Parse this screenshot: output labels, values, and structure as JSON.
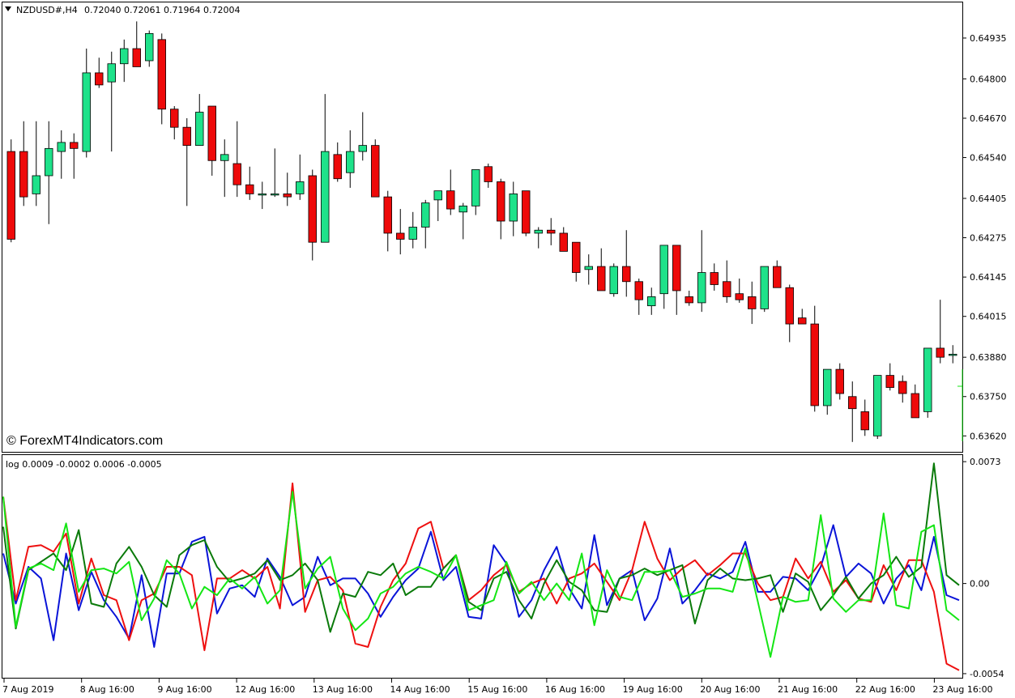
{
  "header": {
    "symbol": "NZDUSD#,H4",
    "ohlc": "0.72040 0.72061 0.71964 0.72004",
    "indicator_label": "log 0.0009 -0.0002 0.0006 -0.0005"
  },
  "watermark": "© ForexMT4Indicators.com",
  "colors": {
    "bull": "#1ee28a",
    "bear": "#ee0a0a",
    "wick": "#000000",
    "blue": "#0a14d8",
    "red": "#ee1010",
    "darkgreen": "#0a7a0a",
    "lime": "#14e614"
  },
  "chart_data": [
    {
      "type": "candlestick",
      "price_ticks": [
        "0.64935",
        "0.64800",
        "0.64670",
        "0.64540",
        "0.64405",
        "0.64275",
        "0.64145",
        "0.64015",
        "0.63880",
        "0.63750",
        "0.63620"
      ],
      "ylim": [
        0.6357,
        0.6505
      ],
      "x_labels": [
        "7 Aug 2019",
        "8 Aug 16:00",
        "9 Aug 16:00",
        "12 Aug 16:00",
        "13 Aug 16:00",
        "14 Aug 16:00",
        "15 Aug 16:00",
        "16 Aug 16:00",
        "19 Aug 16:00",
        "20 Aug 16:00",
        "21 Aug 16:00",
        "22 Aug 16:00",
        "23 Aug 16:00"
      ],
      "candles": [
        [
          0.6456,
          0.646,
          0.6426,
          0.6427
        ],
        [
          0.6456,
          0.6466,
          0.6438,
          0.6441
        ],
        [
          0.6442,
          0.6466,
          0.6438,
          0.6448
        ],
        [
          0.6448,
          0.6466,
          0.6432,
          0.6457
        ],
        [
          0.6456,
          0.6463,
          0.6447,
          0.6459
        ],
        [
          0.6459,
          0.6462,
          0.6447,
          0.6457
        ],
        [
          0.6456,
          0.649,
          0.6454,
          0.6482
        ],
        [
          0.6482,
          0.6487,
          0.6477,
          0.6478
        ],
        [
          0.6479,
          0.6489,
          0.6456,
          0.6485
        ],
        [
          0.6485,
          0.6493,
          0.6479,
          0.649
        ],
        [
          0.649,
          0.6499,
          0.6484,
          0.6484
        ],
        [
          0.6486,
          0.6496,
          0.6484,
          0.6495
        ],
        [
          0.6493,
          0.6495,
          0.6465,
          0.647
        ],
        [
          0.647,
          0.6471,
          0.646,
          0.6464
        ],
        [
          0.6464,
          0.6467,
          0.6438,
          0.6458
        ],
        [
          0.6458,
          0.6475,
          0.6458,
          0.6469
        ],
        [
          0.6471,
          0.6471,
          0.6448,
          0.6453
        ],
        [
          0.6453,
          0.646,
          0.6441,
          0.6455
        ],
        [
          0.6452,
          0.6466,
          0.6441,
          0.6445
        ],
        [
          0.6445,
          0.6451,
          0.644,
          0.6442
        ],
        [
          0.6442,
          0.6446,
          0.6437,
          0.6442
        ],
        [
          0.6442,
          0.6457,
          0.6441,
          0.6442
        ],
        [
          0.6442,
          0.6449,
          0.6438,
          0.6441
        ],
        [
          0.6442,
          0.6455,
          0.644,
          0.6446
        ],
        [
          0.6448,
          0.645,
          0.642,
          0.6426
        ],
        [
          0.6426,
          0.6475,
          0.6426,
          0.6456
        ],
        [
          0.6455,
          0.6459,
          0.6446,
          0.6447
        ],
        [
          0.6449,
          0.6463,
          0.6444,
          0.6456
        ],
        [
          0.6456,
          0.6469,
          0.6453,
          0.6458
        ],
        [
          0.6458,
          0.646,
          0.6442,
          0.6441
        ],
        [
          0.6441,
          0.6443,
          0.6423,
          0.6429
        ],
        [
          0.6429,
          0.6437,
          0.6422,
          0.6427
        ],
        [
          0.6427,
          0.6436,
          0.6424,
          0.6431
        ],
        [
          0.6431,
          0.644,
          0.6424,
          0.6439
        ],
        [
          0.644,
          0.6443,
          0.6433,
          0.6443
        ],
        [
          0.6443,
          0.645,
          0.6435,
          0.6437
        ],
        [
          0.6436,
          0.6439,
          0.6427,
          0.6438
        ],
        [
          0.6438,
          0.645,
          0.6435,
          0.645
        ],
        [
          0.6451,
          0.6452,
          0.6444,
          0.6446
        ],
        [
          0.6446,
          0.6447,
          0.6427,
          0.6433
        ],
        [
          0.6433,
          0.6446,
          0.6428,
          0.6442
        ],
        [
          0.6443,
          0.6443,
          0.6428,
          0.6429
        ],
        [
          0.6429,
          0.6431,
          0.6424,
          0.643
        ],
        [
          0.643,
          0.6434,
          0.6425,
          0.6429
        ],
        [
          0.6429,
          0.6431,
          0.6423,
          0.6423
        ],
        [
          0.6426,
          0.6426,
          0.6413,
          0.6416
        ],
        [
          0.6417,
          0.6422,
          0.6412,
          0.6418
        ],
        [
          0.6418,
          0.6424,
          0.641,
          0.641
        ],
        [
          0.6409,
          0.6419,
          0.6408,
          0.6418
        ],
        [
          0.6418,
          0.643,
          0.6408,
          0.6413
        ],
        [
          0.6413,
          0.6414,
          0.6402,
          0.6407
        ],
        [
          0.6405,
          0.6411,
          0.6402,
          0.6408
        ],
        [
          0.6409,
          0.6425,
          0.6404,
          0.6425
        ],
        [
          0.6425,
          0.6425,
          0.6402,
          0.641
        ],
        [
          0.6408,
          0.641,
          0.6405,
          0.6406
        ],
        [
          0.6406,
          0.643,
          0.6403,
          0.6416
        ],
        [
          0.6416,
          0.6419,
          0.641,
          0.6412
        ],
        [
          0.6413,
          0.642,
          0.6406,
          0.6408
        ],
        [
          0.6409,
          0.6414,
          0.6406,
          0.6407
        ],
        [
          0.6408,
          0.6413,
          0.6399,
          0.6404
        ],
        [
          0.6404,
          0.6418,
          0.6403,
          0.6418
        ],
        [
          0.6418,
          0.642,
          0.6411,
          0.6411
        ],
        [
          0.6411,
          0.6412,
          0.6393,
          0.6399
        ],
        [
          0.6401,
          0.6404,
          0.64,
          0.6399
        ],
        [
          0.6399,
          0.6405,
          0.637,
          0.6372
        ],
        [
          0.6372,
          0.6384,
          0.6369,
          0.6384
        ],
        [
          0.6384,
          0.6386,
          0.6374,
          0.6376
        ],
        [
          0.6375,
          0.638,
          0.636,
          0.6371
        ],
        [
          0.637,
          0.6374,
          0.6362,
          0.6364
        ],
        [
          0.6362,
          0.6382,
          0.6361,
          0.6382
        ],
        [
          0.6382,
          0.6386,
          0.6377,
          0.6378
        ],
        [
          0.638,
          0.6382,
          0.6373,
          0.6376
        ],
        [
          0.6376,
          0.6379,
          0.6368,
          0.6368
        ],
        [
          0.637,
          0.6383,
          0.6368,
          0.6391
        ],
        [
          0.6391,
          0.6407,
          0.6386,
          0.6388
        ],
        [
          0.6389,
          0.6392,
          0.6386,
          0.6389
        ]
      ]
    },
    {
      "type": "line",
      "title": "log 0.0009 -0.0002 0.0006 -0.0005",
      "y_ticks": [
        "0.0073",
        "0.00",
        "-0.0054"
      ],
      "ylim": [
        -0.0055,
        0.0075
      ],
      "series": [
        {
          "color": "#0a14d8",
          "values": [
            0.0018,
            -0.0012,
            0.001,
            0.0003,
            -0.0034,
            0.0018,
            -0.0016,
            0.0007,
            -0.001,
            -0.002,
            -0.0033,
            0.0005,
            -0.0038,
            0.0006,
            0.0006,
            0.0025,
            0.0028,
            -0.0018,
            -0.0003,
            -0.0001,
            -0.0008,
            0.0015,
            0.0004,
            -0.0013,
            -0.0008,
            0.0016,
            -0.0001,
            0.0003,
            0.0003,
            -0.0006,
            -0.002,
            -0.0008,
            0.0002,
            0.0009,
            0.0031,
            0.0002,
            0.001,
            -0.002,
            -0.0021,
            0.0023,
            0.0012,
            -0.002,
            -0.001,
            0.0008,
            0.0022,
            -0.0003,
            -0.0015,
            0.0029,
            -0.0013,
            0.0003,
            0.0008,
            -0.0022,
            -0.0009,
            0.0021,
            -0.0012,
            -0.0004,
            0.0006,
            0.0003,
            0.0007,
            0.0025,
            -0.0005,
            -0.0005,
            0.0004,
            0.0003,
            -0.0004,
            0.001,
            0.0035,
            0.0004,
            0.0012,
            0.0006,
            -0.0012,
            0.0003,
            0.0011,
            -0.0004,
            0.0028,
            -0.0007,
            -0.001
          ]
        },
        {
          "color": "#ee1010",
          "values": [
            0.0052,
            -0.001,
            0.0022,
            0.0023,
            0.0019,
            0.003,
            -0.0012,
            0.0015,
            -0.0007,
            -0.001,
            -0.0034,
            -0.001,
            -0.0006,
            0.001,
            0.001,
            0.0005,
            -0.004,
            0.0003,
            0.0003,
            0.0008,
            0.0003,
            0.001,
            -0.0015,
            0.006,
            -0.0017,
            0.0002,
            0.0004,
            -0.0004,
            -0.0036,
            -0.0038,
            -0.0014,
            0.0002,
            0.0012,
            0.0033,
            0.0037,
            0.0009,
            0.0017,
            -0.001,
            -0.0004,
            0.0005,
            0.0011,
            -0.0005,
            0.0,
            0.0003,
            -0.0012,
            0.0003,
            0.0006,
            0.0012,
            0.0001,
            -0.001,
            0.0008,
            0.0037,
            0.0015,
            0.0002,
            0.0009,
            0.0014,
            0.0005,
            0.0011,
            0.0018,
            0.0018,
            0.0,
            -0.001,
            -0.0008,
            0.0015,
            0.0003,
            0.0013,
            -0.0005,
            0.0002,
            -0.0009,
            -0.0011,
            0.0011,
            -0.0004,
            0.0014,
            0.0014,
            -0.0005,
            -0.0048,
            -0.0052
          ]
        },
        {
          "color": "#0a7a0a",
          "values": [
            0.0034,
            -0.0027,
            0.0008,
            0.0013,
            0.0018,
            0.0008,
            0.0032,
            -0.0012,
            -0.0014,
            0.0012,
            0.0022,
            0.001,
            -0.0007,
            -0.0014,
            0.0017,
            0.0023,
            0.0026,
            0.001,
            0.0001,
            0.0003,
            0.0006,
            0.0014,
            0.0002,
            0.0005,
            0.0012,
            0.0002,
            -0.0029,
            -0.0006,
            -0.0008,
            0.0007,
            0.0005,
            0.0012,
            -0.0007,
            -0.0002,
            -0.0002,
            0.0009,
            0.0017,
            -0.0011,
            -0.0016,
            0.0003,
            0.0007,
            -0.001,
            -0.0021,
            0.0,
            0.0014,
            0.0001,
            -0.0004,
            -0.0016,
            -0.0017,
            0.0003,
            0.0005,
            0.0009,
            0.0005,
            0.0008,
            0.0011,
            -0.0024,
            0.0002,
            0.0009,
            0.0003,
            0.0002,
            0.0003,
            0.0005,
            -0.0017,
            0.0006,
            0.0001,
            -0.0016,
            -0.0007,
            0.0004,
            -0.0009,
            0.0,
            0.0005,
            0.0016,
            0.0004,
            0.001,
            0.0072,
            0.0005,
            -0.0001
          ]
        },
        {
          "color": "#14e614",
          "values": [
            0.0052,
            -0.0026,
            0.0009,
            0.0012,
            0.0008,
            0.0036,
            -0.0005,
            0.0008,
            0.0009,
            0.0006,
            0.0013,
            -0.0022,
            -0.0009,
            0.0014,
            0.0006,
            -0.0015,
            -0.0002,
            -0.0007,
            0.0003,
            -0.0003,
            0.0004,
            -0.0012,
            -0.0004,
            0.0055,
            -0.0003,
            0.0009,
            0.0016,
            -0.0015,
            -0.0028,
            -0.0021,
            -0.0006,
            -0.0002,
            0.0006,
            0.001,
            0.0007,
            0.0003,
            0.0017,
            -0.0016,
            -0.0013,
            -0.001,
            0.0013,
            -0.0006,
            0.0001,
            -0.001,
            0.0,
            -0.001,
            0.0018,
            -0.0025,
            0.0008,
            -0.0008,
            -0.001,
            0.0007,
            0.0007,
            0.0008,
            -0.0008,
            -0.0006,
            -0.0003,
            -0.0003,
            -0.0005,
            0.0021,
            -0.0011,
            -0.0044,
            -0.0008,
            -0.0011,
            -0.001,
            0.0041,
            -0.0009,
            -0.0017,
            -0.001,
            -0.001,
            0.0042,
            -0.0013,
            -0.0015,
            0.0031,
            0.0035,
            -0.0016,
            -0.0022
          ]
        }
      ]
    }
  ]
}
